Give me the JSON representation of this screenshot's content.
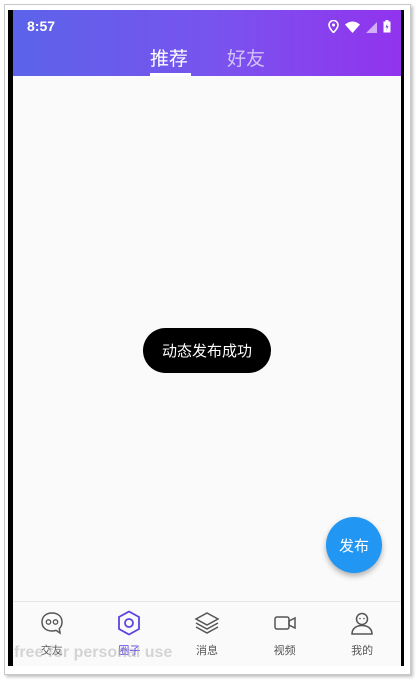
{
  "status": {
    "time": "8:57"
  },
  "tabs": [
    {
      "label": "推荐",
      "active": true
    },
    {
      "label": "好友",
      "active": false
    }
  ],
  "toast": {
    "text": "动态发布成功"
  },
  "fab": {
    "label": "发布",
    "color": "#2196f3"
  },
  "nav": [
    {
      "label": "交友",
      "icon": "chat-bubble-icon"
    },
    {
      "label": "圈子",
      "icon": "hexagon-icon",
      "active": true
    },
    {
      "label": "消息",
      "icon": "layers-icon"
    },
    {
      "label": "视频",
      "icon": "video-camera-icon"
    },
    {
      "label": "我的",
      "icon": "user-icon"
    }
  ],
  "watermark": "free for personal use",
  "colors": {
    "header_start": "#5b63ea",
    "header_end": "#9233ee",
    "active_nav": "#5a45e0"
  }
}
